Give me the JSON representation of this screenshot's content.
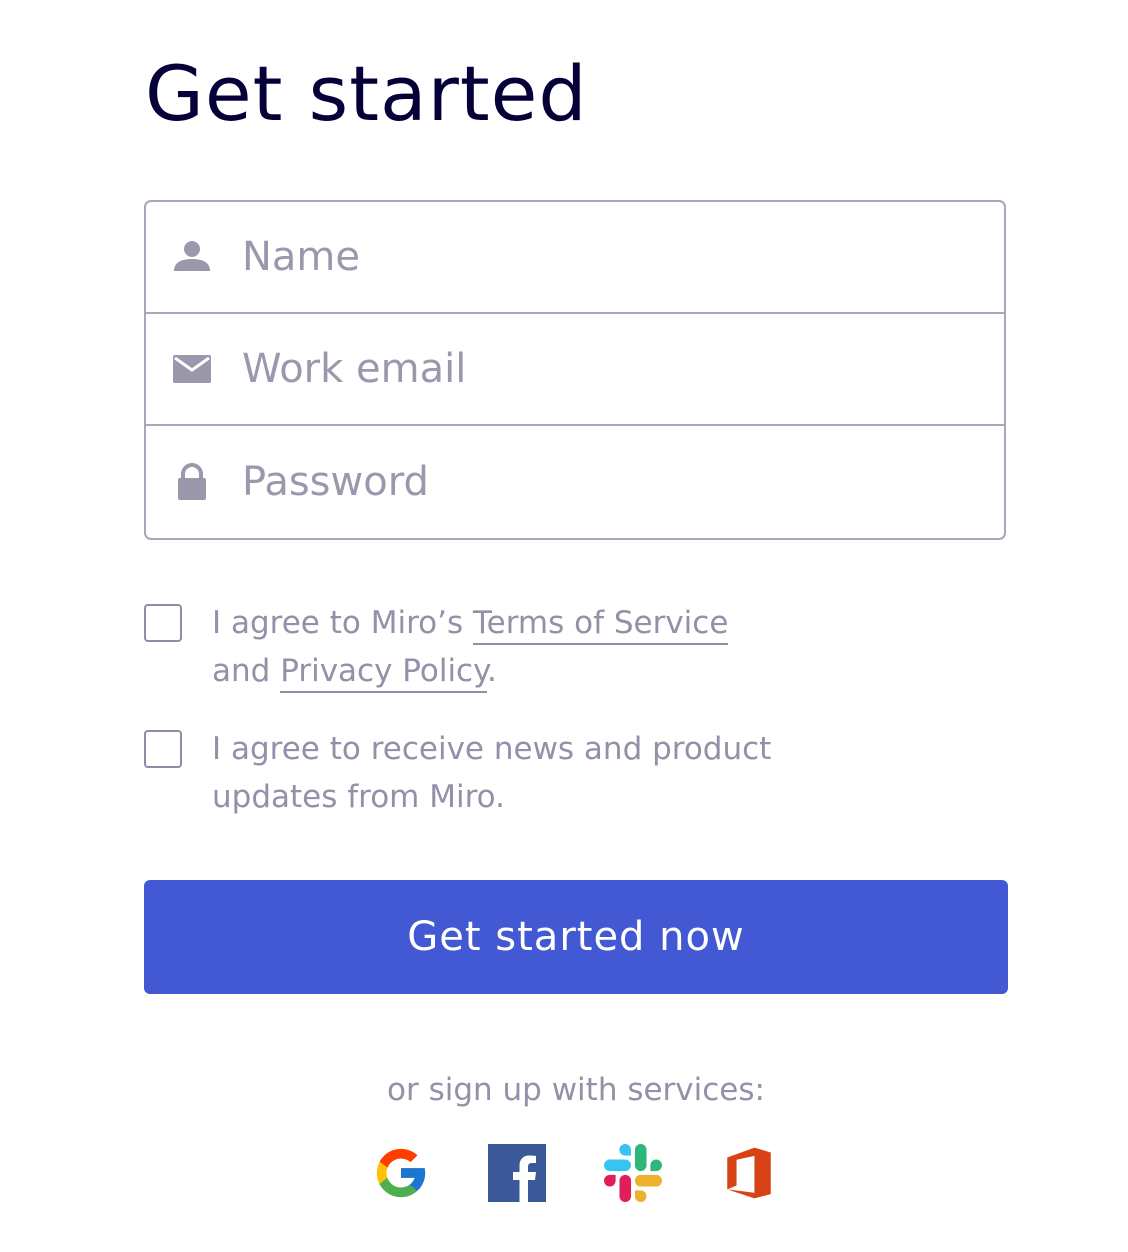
{
  "page": {
    "title": "Get started"
  },
  "form": {
    "name_placeholder": "Name",
    "email_placeholder": "Work email",
    "password_placeholder": "Password"
  },
  "consents": {
    "terms": {
      "prefix": "I agree to Miro’s ",
      "terms_link": "Terms of Service",
      "middle": "and ",
      "privacy_link": "Privacy Policy",
      "suffix": "."
    },
    "news": {
      "line1": "I agree to receive news and product",
      "line2": "updates from Miro."
    }
  },
  "cta": {
    "label": "Get started now",
    "color": "#4259d3"
  },
  "services": {
    "label": "or sign up with services:",
    "items": [
      {
        "name": "google",
        "icon": "google-icon"
      },
      {
        "name": "facebook",
        "icon": "facebook-icon"
      },
      {
        "name": "slack",
        "icon": "slack-icon"
      },
      {
        "name": "office",
        "icon": "office-icon"
      }
    ]
  },
  "colors": {
    "title": "#050038",
    "muted_text": "#9390a8",
    "border": "#a8a6b8",
    "icon": "#9a98ad"
  }
}
